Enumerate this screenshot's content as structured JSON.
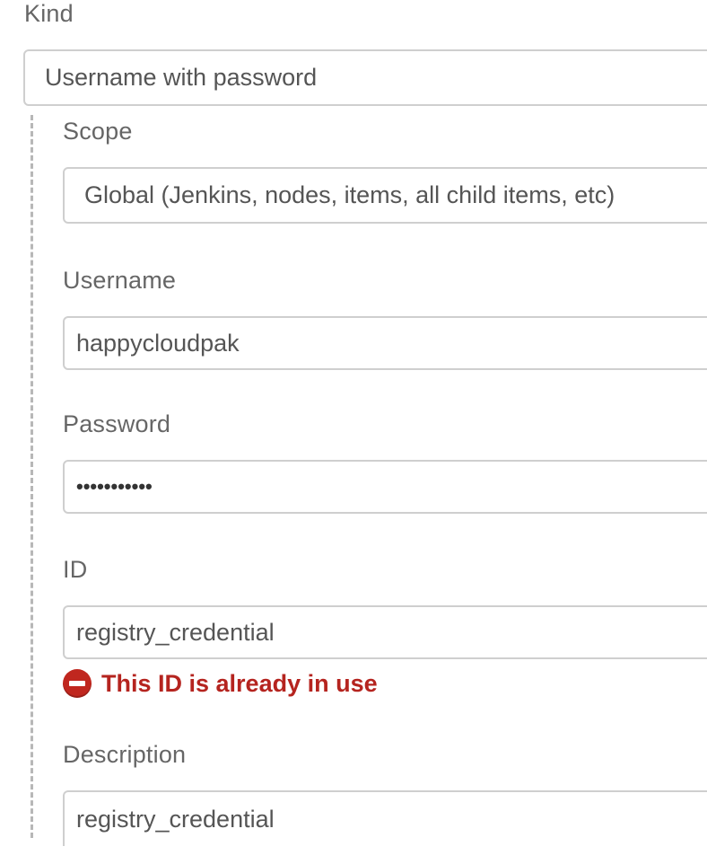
{
  "kind": {
    "label": "Kind",
    "value": "Username with password"
  },
  "scope": {
    "label": "Scope",
    "value": "Global (Jenkins, nodes, items, all child items, etc)"
  },
  "username": {
    "label": "Username",
    "value": "happycloudpak"
  },
  "password": {
    "label": "Password",
    "masked_value": "•••••••••••"
  },
  "id": {
    "label": "ID",
    "value": "registry_credential",
    "error": "This ID is already in use"
  },
  "description": {
    "label": "Description",
    "value": "registry_credential"
  },
  "colors": {
    "error": "#b5241f",
    "border": "#cfcfcf",
    "label": "#666666"
  }
}
